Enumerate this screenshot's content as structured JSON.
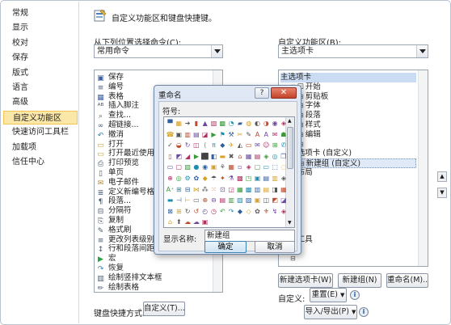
{
  "sidebar": {
    "items": [
      {
        "label": "常规"
      },
      {
        "label": "显示"
      },
      {
        "label": "校对"
      },
      {
        "label": "保存"
      },
      {
        "label": "版式"
      },
      {
        "label": "语言"
      },
      {
        "label": "高级"
      },
      {
        "label": "自定义功能区",
        "active": true
      },
      {
        "label": "快速访问工具栏"
      },
      {
        "label": "加载项"
      },
      {
        "label": "信任中心"
      }
    ]
  },
  "header": {
    "title": "自定义功能区和键盘快捷键。",
    "icon": "ribbon-customize-icon"
  },
  "commands": {
    "label": "从下列位置选择命令(C):",
    "selected": "常用命令",
    "items": [
      {
        "icon": "save-icon",
        "label": "保存"
      },
      {
        "icon": "numbering-icon",
        "label": "编号"
      },
      {
        "icon": "table-icon",
        "label": "表格"
      },
      {
        "icon": "footnote-icon",
        "label": "插入脚注"
      },
      {
        "icon": "find-icon",
        "label": "查找..."
      },
      {
        "icon": "hyperlink-icon",
        "label": "超链接..."
      },
      {
        "icon": "undo-icon",
        "label": "撤消"
      },
      {
        "icon": "open-icon",
        "label": "打开"
      },
      {
        "icon": "open-recent-icon",
        "label": "打开最近使用过"
      },
      {
        "icon": "print-preview-icon",
        "label": "打印预览"
      },
      {
        "icon": "single-page-icon",
        "label": "单页"
      },
      {
        "icon": "email-icon",
        "label": "电子邮件"
      },
      {
        "icon": "new-comment-icon",
        "label": "定义新编号格式"
      },
      {
        "icon": "paragraph-icon",
        "label": "段落..."
      },
      {
        "icon": "section-break-icon",
        "label": "分隔符"
      },
      {
        "icon": "copy-icon",
        "label": "复制"
      },
      {
        "icon": "format-painter-icon",
        "label": "格式刷"
      },
      {
        "icon": "list-level-icon",
        "label": "更改列表级别"
      },
      {
        "icon": "line-spacing-icon",
        "label": "行和段落间距"
      },
      {
        "icon": "macro-icon",
        "label": "宏"
      },
      {
        "icon": "redo-icon",
        "label": "恢复"
      },
      {
        "icon": "vertical-textbox-icon",
        "label": "绘制竖排文本框"
      },
      {
        "icon": "draw-table-icon",
        "label": "绘制表格"
      }
    ]
  },
  "ribbon": {
    "label": "自定义功能区(B):",
    "selected": "主选项卡",
    "items": [
      {
        "label": "主选项卡",
        "indent": 0,
        "highlight": true
      },
      {
        "label": "开始",
        "indent": 1,
        "checked": true
      },
      {
        "label": "剪贴板",
        "indent": 2
      },
      {
        "label": "字体",
        "indent": 2
      },
      {
        "label": "段落",
        "indent": 2
      },
      {
        "label": "样式",
        "indent": 2
      },
      {
        "label": "编辑",
        "indent": 2
      },
      {
        "label": "",
        "indent": 2
      },
      {
        "label": "选项卡 (自定义)",
        "indent": 1
      },
      {
        "label": "新建组 (自定义)",
        "indent": 2,
        "selected": true
      },
      {
        "label": "布局",
        "indent": 1
      },
      {
        "label": "",
        "indent": 1
      },
      {
        "label": "",
        "indent": 1
      },
      {
        "label": "",
        "indent": 1
      },
      {
        "label": "",
        "indent": 1
      },
      {
        "label": "",
        "indent": 1
      },
      {
        "label": "",
        "indent": 1
      },
      {
        "label": "工具",
        "indent": 1
      },
      {
        "label": "",
        "indent": 1
      },
      {
        "label": "",
        "indent": 1
      }
    ],
    "new_tab": "新建选项卡(W)",
    "new_group": "新建组(N)",
    "rename": "重命名(M)...",
    "custom_label": "自定义:",
    "reset": "重置(E)",
    "import_export": "导入/导出(P)"
  },
  "keyboard": {
    "label": "键盘快捷方式:",
    "button": "自定义(T)..."
  },
  "dialog": {
    "title": "重命名",
    "help": "?",
    "close": "✕",
    "symbol_label": "符号:",
    "name_label": "显示名称:",
    "name_value": "新建组",
    "ok": "确定",
    "cancel": "取消",
    "symbols": [
      "▀",
      "▦",
      "➔",
      "▮",
      "▲",
      "▧",
      "▩",
      "◔",
      "▰",
      "◍",
      "◐",
      "◑",
      "◉",
      "◈",
      "☎",
      "▣",
      "▥",
      "▤",
      "◪",
      "▶",
      "⚑",
      "⚒",
      "✂",
      "✎",
      "A",
      "A",
      "✉",
      "☗",
      "✓",
      "◒",
      "↻",
      "◫",
      "⟨",
      "π",
      "◆",
      "✈",
      "◭",
      "▭",
      "✉",
      "☺",
      "⊞",
      "✆",
      "▯",
      "◩",
      "◢",
      "▶",
      "⬛",
      "◧",
      "▬",
      "✖",
      "⌂",
      "▦",
      "▤",
      "◈",
      "◎",
      "❒",
      "▭",
      "▢",
      "▨",
      "●",
      "◉",
      "▣",
      "⚘",
      "▦",
      "▫",
      "◈",
      "▢",
      "▭",
      "⬚",
      "◌",
      "⊕",
      "◎",
      "⚙",
      "✿",
      "◆",
      "☂",
      "✦",
      "⚗",
      "▩",
      "◳",
      "▣",
      "▤",
      "▥",
      "◈",
      "A⁺",
      "⊞",
      "⊟",
      "⋈",
      "⁂",
      "⁙",
      "⊡",
      "◲",
      "▦",
      "▩",
      "▥",
      "▤",
      "◨",
      "▦",
      "▬",
      "⊣",
      "⊢",
      "▭",
      "⊕",
      "⊖",
      "▤",
      "▥",
      "▧",
      "▨",
      "▣",
      "◫",
      "◩",
      "◪",
      "⊠",
      "⊞",
      "↻",
      "↺",
      "◴",
      "◷",
      "↶",
      "↷",
      "◆",
      "◇",
      "✿",
      "⚜",
      "↯",
      "◈",
      "⌂",
      "⬆",
      "☁",
      "☁",
      "▣"
    ]
  }
}
